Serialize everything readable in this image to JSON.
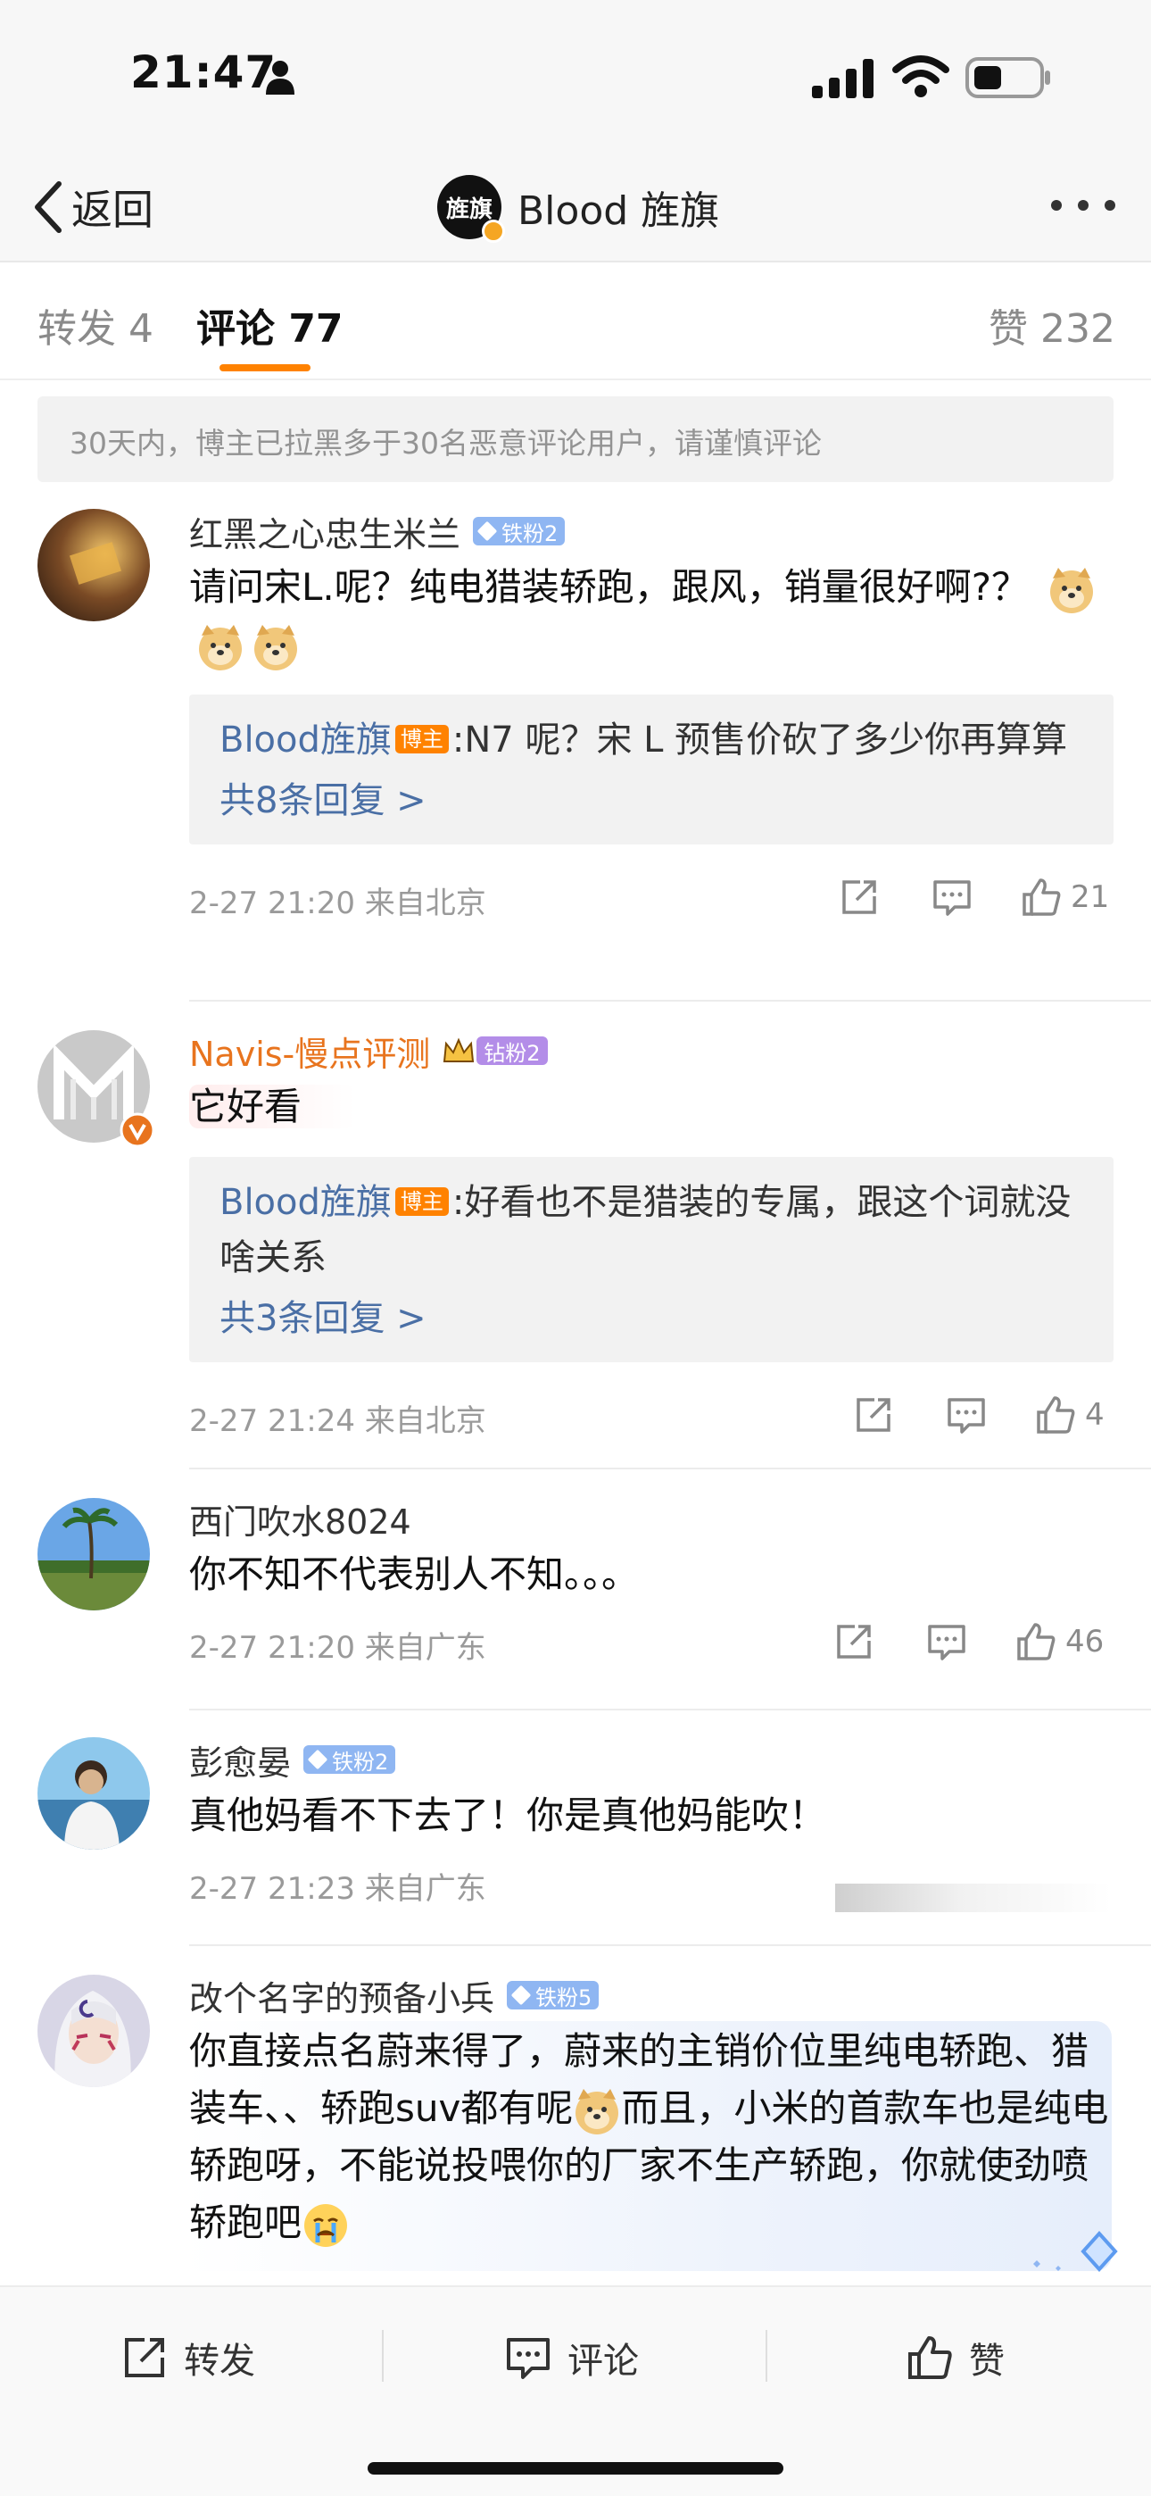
{
  "status_bar": {
    "time": "21:47"
  },
  "nav": {
    "back_label": "返回",
    "avatar_text": "旌旗",
    "title": "Blood 旌旗"
  },
  "tabs": [
    {
      "label": "转发 4"
    },
    {
      "label": "评论 77"
    },
    {
      "label": "赞 232"
    }
  ],
  "notice": "30天内，博主已拉黑多于30名恶意评论用户，请谨慎评论",
  "comments": [
    {
      "username": "红黑之心忠生米兰",
      "badge": "铁粉2",
      "text": "请问宋L.呢？纯电猎装轿跑，跟风，销量很好啊?？",
      "reply_author": "Blood旌旗",
      "owner_badge": "博主",
      "reply_text": ":N7 呢？宋 L 预售价砍了多少你再算算",
      "reply_more": "共8条回复 >",
      "time_loc": "2-27 21:20  来自北京",
      "likes": "21"
    },
    {
      "username": "Navis-慢点评测",
      "badge": "钻粉2",
      "text": "它好看",
      "reply_author": "Blood旌旗",
      "owner_badge": "博主",
      "reply_text": ":好看也不是猎装的专属，跟这个词就没啥关系",
      "reply_more": "共3条回复 >",
      "time_loc": "2-27 21:24  来自北京",
      "likes": "4"
    },
    {
      "username": "西门吹水8024",
      "text": "你不知不代表别人不知。。。",
      "time_loc": "2-27 21:20  来自广东",
      "likes": "46"
    },
    {
      "username": "彭愈晏",
      "badge": "铁粉2",
      "text": "真他妈看不下去了！你是真他妈能吹！",
      "time_loc": "2-27 21:23  来自广东"
    },
    {
      "username": "改个名字的预备小兵",
      "badge": "铁粉5",
      "text_a": "你直接点名蔚来得了，蔚来的主销价位里纯电轿跑、猎装车、、轿跑suv都有呢",
      "text_b": "而且，小米的首款车也是纯电轿跑呀，不能说投喂你的厂家不生产轿跑，你就使劲喷轿跑吧"
    }
  ],
  "bottom_bar": {
    "repost": "转发",
    "comment": "评论",
    "like": "赞"
  },
  "colors": {
    "accent": "#ff8200",
    "link": "#4a6fa5",
    "vip_name": "#e8741e",
    "iron_badge": "#8fb6f2",
    "diamond_badge": "#b38de8"
  }
}
